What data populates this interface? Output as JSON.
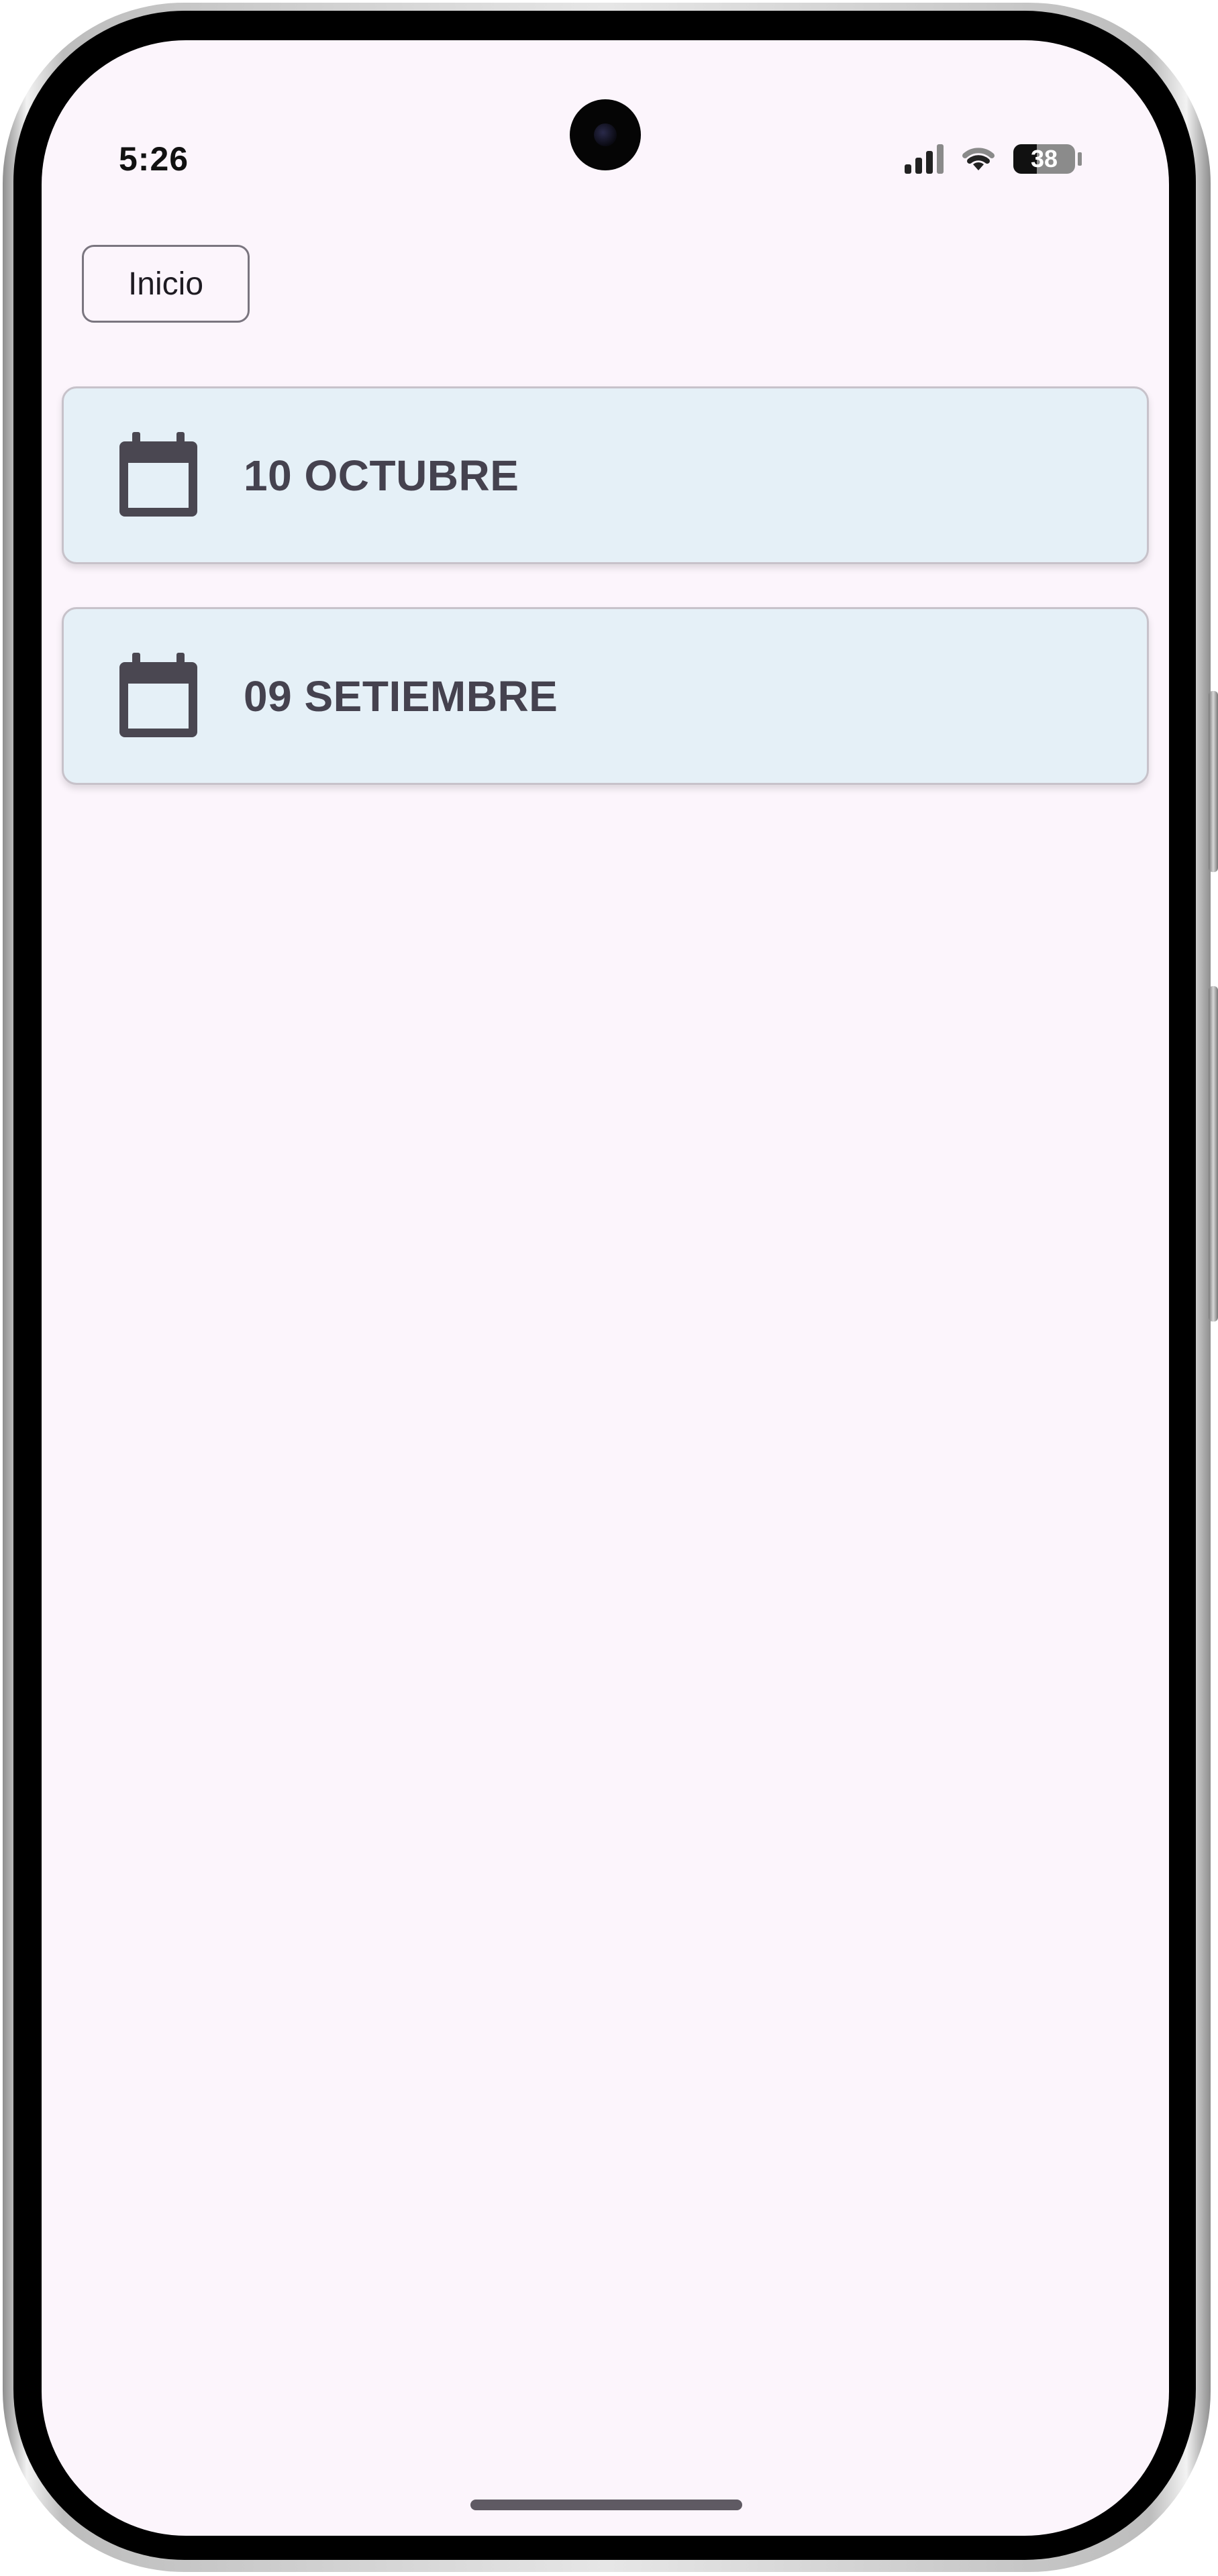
{
  "status_bar": {
    "time": "5:26",
    "battery": "38",
    "battery_level": 0.38
  },
  "header": {
    "home_button_label": "Inicio"
  },
  "list": {
    "items": [
      {
        "label": "10 OCTUBRE",
        "icon": "calendar-icon"
      },
      {
        "label": "09 SETIEMBRE",
        "icon": "calendar-icon"
      }
    ]
  },
  "colors": {
    "screen_background": "#fcf5fc",
    "card_background": "#e5f0f7",
    "card_text": "#45424f"
  }
}
